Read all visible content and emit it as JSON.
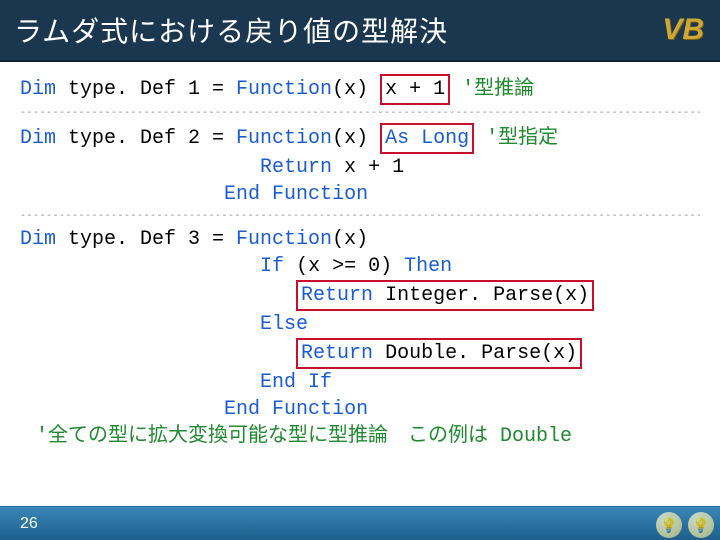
{
  "header": {
    "title": "ラムダ式における戻り値の型解決",
    "badge": "VB"
  },
  "kw": {
    "dim": "Dim",
    "function": "Function",
    "as_long": "As Long",
    "return": "Return",
    "end_function": "End Function",
    "if": "If",
    "then": "Then",
    "else": "Else",
    "end_if": "End If",
    "integer": "Integer",
    "double": "Double"
  },
  "code": {
    "b1": {
      "decl": " type. Def 1 = ",
      "args": "(x) ",
      "expr": "x + 1",
      "comment": " '型推論"
    },
    "b2": {
      "decl": " type. Def 2 = ",
      "args": "(x) ",
      "comment": " '型指定",
      "ret": " x + 1"
    },
    "b3": {
      "decl": " type. Def 3 = ",
      "args": "(x)",
      "if_cond": " (x >= 0) ",
      "ret_int": " Integer. Parse(x)",
      "ret_dbl": " Double. Parse(x)"
    },
    "comment_footer": " '全ての型に拡大変換可能な型に型推論　この例は Double"
  },
  "sep": "--------------------------------------------------------------------------------------------------------------------------",
  "footer": {
    "page": "26"
  }
}
